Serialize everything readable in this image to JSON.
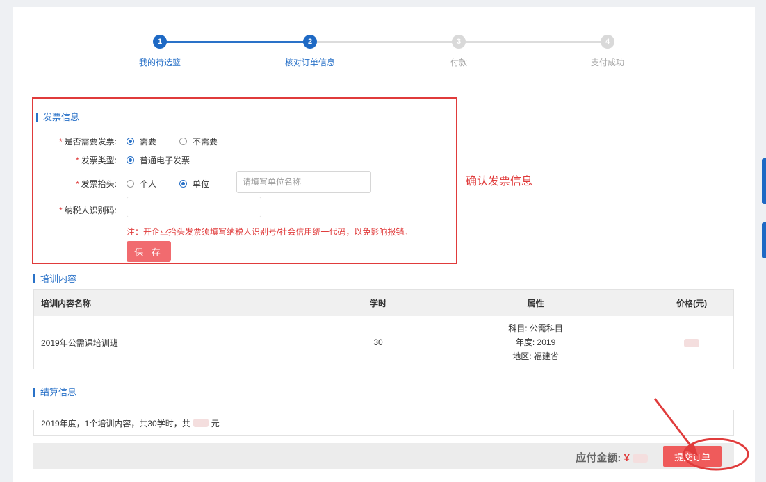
{
  "steps": [
    {
      "num": "1",
      "label": "我的待选篮",
      "state": "done"
    },
    {
      "num": "2",
      "label": "核对订单信息",
      "state": "done"
    },
    {
      "num": "3",
      "label": "付款",
      "state": "todo"
    },
    {
      "num": "4",
      "label": "支付成功",
      "state": "todo"
    }
  ],
  "invoice": {
    "section_title": "发票信息",
    "need_label": "是否需要发票:",
    "need_options": [
      "需要",
      "不需要"
    ],
    "type_label": "发票类型:",
    "type_option": "普通电子发票",
    "header_label": "发票抬头:",
    "header_options": [
      "个人",
      "单位"
    ],
    "company_placeholder": "请填写单位名称",
    "tax_label": "纳税人识别码:",
    "tax_value": "",
    "note": "注：开企业抬头发票须填写纳税人识别号/社会信用统一代码，以免影响报销。",
    "save_label": "保 存"
  },
  "annotation": "确认发票信息",
  "training": {
    "section_title": "培训内容",
    "headers": [
      "培训内容名称",
      "学时",
      "属性",
      "价格(元)"
    ],
    "row": {
      "name": "2019年公需课培训班",
      "hours": "30",
      "attrs": [
        "科目: 公需科目",
        "年度: 2019",
        "地区: 福建省"
      ]
    }
  },
  "settlement": {
    "section_title": "结算信息",
    "summary_prefix": "2019年度，1个培训内容，共30学时，共",
    "summary_suffix": "元",
    "pay_label": "应付金额:",
    "currency": "¥",
    "submit_label": "提交订单"
  },
  "colors": {
    "accent": "#2a72c8",
    "alert": "#e03b3b",
    "button": "#f16b6f"
  }
}
